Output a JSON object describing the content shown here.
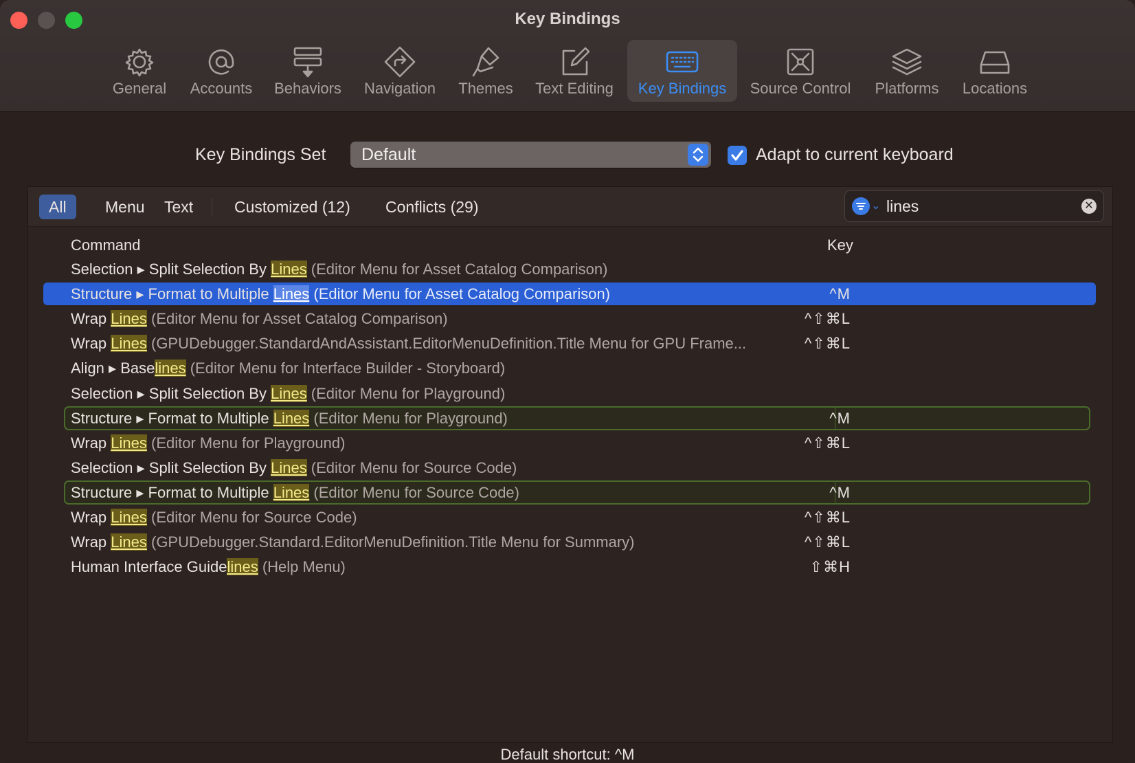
{
  "window": {
    "title": "Key Bindings"
  },
  "toolbar": {
    "tabs": [
      {
        "label": "General",
        "icon": "gear-icon"
      },
      {
        "label": "Accounts",
        "icon": "at-icon"
      },
      {
        "label": "Behaviors",
        "icon": "behaviors-icon"
      },
      {
        "label": "Navigation",
        "icon": "navigation-icon"
      },
      {
        "label": "Themes",
        "icon": "brush-icon"
      },
      {
        "label": "Text Editing",
        "icon": "edit-icon"
      },
      {
        "label": "Key Bindings",
        "icon": "keyboard-icon"
      },
      {
        "label": "Source Control",
        "icon": "source-control-icon"
      },
      {
        "label": "Platforms",
        "icon": "layers-icon"
      },
      {
        "label": "Locations",
        "icon": "drive-icon"
      }
    ],
    "active_tab": "Key Bindings"
  },
  "settings": {
    "set_label": "Key Bindings Set",
    "set_value": "Default",
    "adapt_label": "Adapt to current keyboard",
    "adapt_checked": true
  },
  "filters": {
    "all": "All",
    "menu": "Menu",
    "text": "Text",
    "customized": "Customized (12)",
    "conflicts": "Conflicts (29)",
    "active": "All"
  },
  "search": {
    "value": "lines"
  },
  "columns": {
    "command": "Command",
    "key": "Key"
  },
  "rows": [
    {
      "pre": "Selection ▸ Split Selection By ",
      "match": "Lines",
      "post": "",
      "context": " (Editor Menu for Asset Catalog Comparison)",
      "key": "",
      "state": "normal"
    },
    {
      "pre": "Structure ▸ Format to Multiple ",
      "match": "Lines",
      "post": "",
      "context": " (Editor Menu for Asset Catalog Comparison)",
      "key": "^M",
      "state": "selected"
    },
    {
      "pre": "Wrap ",
      "match": "Lines",
      "post": "",
      "context": " (Editor Menu for Asset Catalog Comparison)",
      "key": "^⇧⌘L",
      "state": "normal"
    },
    {
      "pre": "Wrap ",
      "match": "Lines",
      "post": "",
      "context": " (GPUDebugger.StandardAndAssistant.EditorMenuDefinition.Title Menu for GPU Frame...",
      "key": "^⇧⌘L",
      "state": "normal"
    },
    {
      "pre": "Align ▸ Base",
      "match": "lines",
      "post": "",
      "context": " (Editor Menu for Interface Builder - Storyboard)",
      "key": "",
      "state": "normal"
    },
    {
      "pre": "Selection ▸ Split Selection By ",
      "match": "Lines",
      "post": "",
      "context": " (Editor Menu for Playground)",
      "key": "",
      "state": "normal"
    },
    {
      "pre": "Structure ▸ Format to Multiple ",
      "match": "Lines",
      "post": "",
      "context": " (Editor Menu for Playground)",
      "key": "^M",
      "state": "conflict"
    },
    {
      "pre": "Wrap ",
      "match": "Lines",
      "post": "",
      "context": " (Editor Menu for Playground)",
      "key": "^⇧⌘L",
      "state": "normal"
    },
    {
      "pre": "Selection ▸ Split Selection By ",
      "match": "Lines",
      "post": "",
      "context": " (Editor Menu for Source Code)",
      "key": "",
      "state": "normal"
    },
    {
      "pre": "Structure ▸ Format to Multiple ",
      "match": "Lines",
      "post": "",
      "context": " (Editor Menu for Source Code)",
      "key": "^M",
      "state": "conflict"
    },
    {
      "pre": "Wrap ",
      "match": "Lines",
      "post": "",
      "context": " (Editor Menu for Source Code)",
      "key": "^⇧⌘L",
      "state": "normal"
    },
    {
      "pre": "Wrap ",
      "match": "Lines",
      "post": "",
      "context": " (GPUDebugger.Standard.EditorMenuDefinition.Title Menu for Summary)",
      "key": "^⇧⌘L",
      "state": "normal"
    },
    {
      "pre": "Human Interface Guide",
      "match": "lines",
      "post": "",
      "context": " (Help Menu)",
      "key": "⇧⌘H",
      "state": "normal"
    }
  ],
  "footer": {
    "text": "Default shortcut: ^M"
  },
  "colors": {
    "accent": "#3b8ef5",
    "selection": "#2a5fd6",
    "conflict_border": "#4a6b2c",
    "match_highlight": "#6a5e1a"
  }
}
